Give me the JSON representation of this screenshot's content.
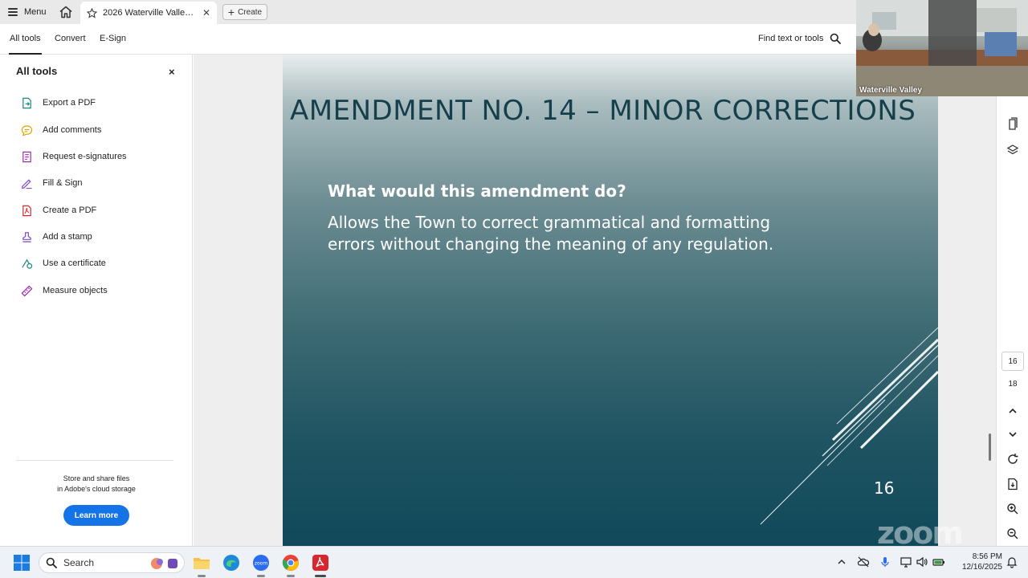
{
  "tabbar": {
    "menu_label": "Menu",
    "doc_tab_title": "2026 Waterville Valley Sl...",
    "create_label": "Create"
  },
  "toolbar": {
    "tabs": [
      "All tools",
      "Convert",
      "E-Sign"
    ],
    "find_label": "Find text or tools"
  },
  "left_panel": {
    "title": "All tools",
    "close": "×",
    "tools": [
      {
        "label": "Export a PDF",
        "icon": "export-pdf-icon"
      },
      {
        "label": "Add comments",
        "icon": "comment-icon"
      },
      {
        "label": "Request e-signatures",
        "icon": "request-signature-icon"
      },
      {
        "label": "Fill & Sign",
        "icon": "fill-sign-icon"
      },
      {
        "label": "Create a PDF",
        "icon": "create-pdf-icon"
      },
      {
        "label": "Add a stamp",
        "icon": "stamp-icon"
      },
      {
        "label": "Use a certificate",
        "icon": "certificate-icon"
      },
      {
        "label": "Measure objects",
        "icon": "ruler-icon"
      }
    ],
    "store_line1": "Store and share files",
    "store_line2": "in Adobe's cloud storage",
    "learn_more": "Learn more"
  },
  "slide": {
    "title": "AMENDMENT NO. 14 – MINOR CORRECTIONS",
    "question": "What would this amendment do?",
    "body": "Allows the Town to correct grammatical and formatting errors without changing the meaning of any regulation.",
    "page_number": "16"
  },
  "right_rail": {
    "current_page": "16",
    "total_pages": "18"
  },
  "webcam": {
    "label": "Waterville Valley"
  },
  "watermark": "zoom",
  "taskbar": {
    "search_label": "Search",
    "time": "8:56 PM",
    "date": "12/16/2025"
  },
  "colors": {
    "accent": "#1473e6",
    "slide_title": "#163f4c",
    "acrobat_red": "#d7282f"
  }
}
